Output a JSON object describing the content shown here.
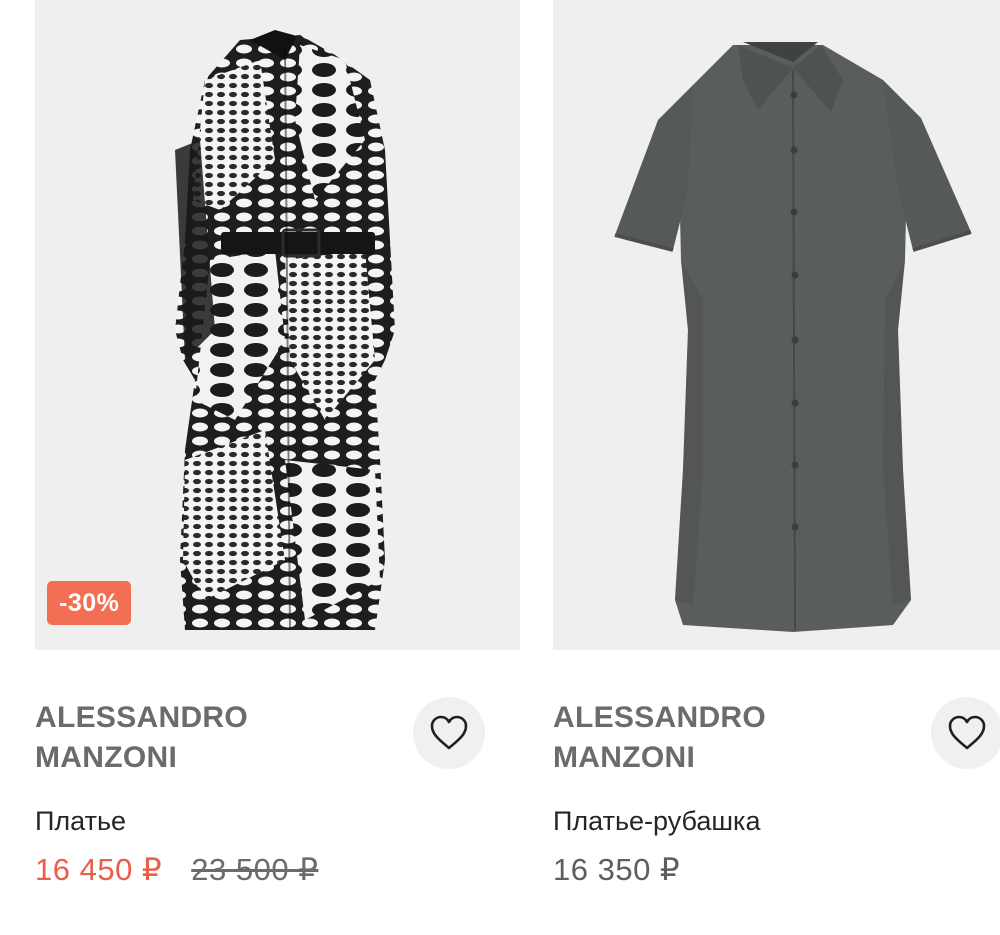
{
  "colors": {
    "image_bg": "#efefef",
    "discount_badge": "#f26f55",
    "sale_price": "#e8604a",
    "brand_text": "#6b6b6b",
    "fav_bg": "#f0f0f0"
  },
  "products": [
    {
      "image_icon": "patterned-shirt-dress-photo",
      "discount_badge": "-30%",
      "brand_line1": "ALESSANDRO",
      "brand_line2": "MANZONI",
      "title": "Платье",
      "price": "16 450 ₽",
      "old_price": "23 500 ₽",
      "favorite_icon": "heart-icon"
    },
    {
      "image_icon": "grey-shirt-dress-photo",
      "brand_line1": "ALESSANDRO",
      "brand_line2": "MANZONI",
      "title": "Платье-рубашка",
      "price": "16 350 ₽",
      "favorite_icon": "heart-icon"
    }
  ]
}
